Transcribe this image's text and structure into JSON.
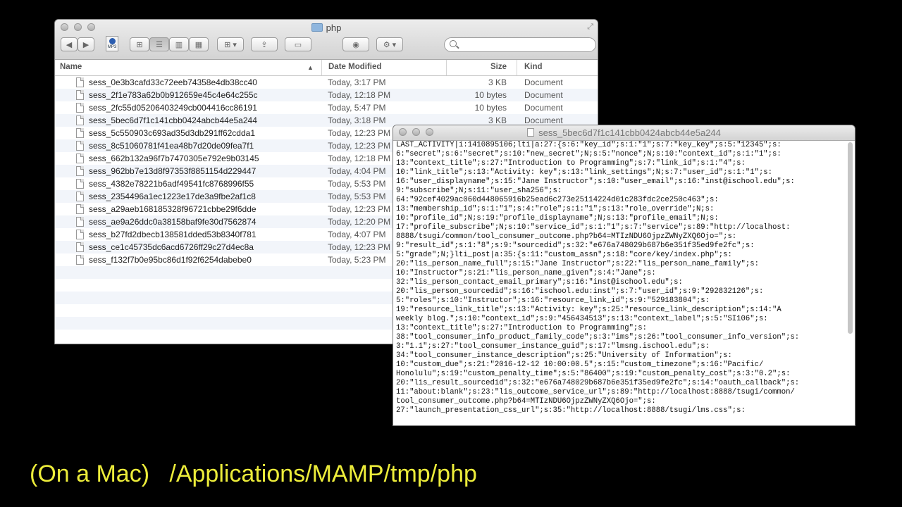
{
  "finder": {
    "title": "php",
    "toolbar_file_label": "MP3",
    "columns": {
      "name": "Name",
      "date": "Date Modified",
      "size": "Size",
      "kind": "Kind"
    },
    "sort_arrow": "▲",
    "files": [
      {
        "name": "sess_0e3b3cafd33c72eeb74358e4db38cc40",
        "date": "Today, 3:17 PM",
        "size": "3 KB",
        "kind": "Document"
      },
      {
        "name": "sess_2f1e783a62b0b912659e45c4e64c255c",
        "date": "Today, 12:18 PM",
        "size": "10 bytes",
        "kind": "Document"
      },
      {
        "name": "sess_2fc55d05206403249cb004416cc86191",
        "date": "Today, 5:47 PM",
        "size": "10 bytes",
        "kind": "Document"
      },
      {
        "name": "sess_5bec6d7f1c141cbb0424abcb44e5a244",
        "date": "Today, 3:18 PM",
        "size": "3 KB",
        "kind": "Document"
      },
      {
        "name": "sess_5c550903c693ad35d3db291ff62cdda1",
        "date": "Today, 12:23 PM",
        "size": "",
        "kind": ""
      },
      {
        "name": "sess_8c51060781f41ea48b7d20de09fea7f1",
        "date": "Today, 12:23 PM",
        "size": "",
        "kind": ""
      },
      {
        "name": "sess_662b132a96f7b7470305e792e9b03145",
        "date": "Today, 12:18 PM",
        "size": "",
        "kind": ""
      },
      {
        "name": "sess_962bb7e13d8f97353f8851154d229447",
        "date": "Today, 4:04 PM",
        "size": "",
        "kind": ""
      },
      {
        "name": "sess_4382e78221b6adf49541fc8768996f55",
        "date": "Today, 5:53 PM",
        "size": "",
        "kind": ""
      },
      {
        "name": "sess_2354496a1ec1223e17de3a9fbe2af1c8",
        "date": "Today, 5:53 PM",
        "size": "",
        "kind": ""
      },
      {
        "name": "sess_a29aeb168185328f96721cbbe29f6dde",
        "date": "Today, 12:23 PM",
        "size": "",
        "kind": ""
      },
      {
        "name": "sess_ae9a26ddc0a38158baf9fe30d7562874",
        "date": "Today, 12:20 PM",
        "size": "",
        "kind": ""
      },
      {
        "name": "sess_b27fd2dbecb138581dded53b8340f781",
        "date": "Today, 4:07 PM",
        "size": "",
        "kind": ""
      },
      {
        "name": "sess_ce1c45735dc6acd6726ff29c27d4ec8a",
        "date": "Today, 12:23 PM",
        "size": "",
        "kind": ""
      },
      {
        "name": "sess_f132f7b0e95bc86d1f92f6254dabebe0",
        "date": "Today, 5:23 PM",
        "size": "",
        "kind": ""
      }
    ]
  },
  "viewer": {
    "title": "sess_5bec6d7f1c141cbb0424abcb44e5a244",
    "lines": [
      "LAST_ACTIVITY|i:1410895106;lti|a:27:{s:6:\"key_id\";s:1:\"1\";s:7:\"key_key\";s:5:\"12345\";s:",
      "6:\"secret\";s:6:\"secret\";s:10:\"new_secret\";N;s:5:\"nonce\";N;s:10:\"context_id\";s:1:\"1\";s:",
      "13:\"context_title\";s:27:\"Introduction to Programming\";s:7:\"link_id\";s:1:\"4\";s:",
      "10:\"link_title\";s:13:\"Activity: key\";s:13:\"link_settings\";N;s:7:\"user_id\";s:1:\"1\";s:",
      "16:\"user_displayname\";s:15:\"Jane Instructor\";s:10:\"user_email\";s:16:\"inst@ischool.edu\";s:",
      "9:\"subscribe\";N;s:11:\"user_sha256\";s:",
      "64:\"92cef4029ac060d448065916b25ead6c273e25114224d01c283fdc2ce250c463\";s:",
      "13:\"membership_id\";s:1:\"1\";s:4:\"role\";s:1:\"1\";s:13:\"role_override\";N;s:",
      "10:\"profile_id\";N;s:19:\"profile_displayname\";N;s:13:\"profile_email\";N;s:",
      "17:\"profile_subscribe\";N;s:10:\"service_id\";s:1:\"1\";s:7:\"service\";s:89:\"http://localhost:",
      "8888/tsugi/common/tool_consumer_outcome.php?b64=MTIzNDU6OjpzZWNyZXQ6Ojo=\";s:",
      "9:\"result_id\";s:1:\"8\";s:9:\"sourcedid\";s:32:\"e676a748029b687b6e351f35ed9fe2fc\";s:",
      "5:\"grade\";N;}lti_post|a:35:{s:11:\"custom_assn\";s:18:\"core/key/index.php\";s:",
      "20:\"lis_person_name_full\";s:15:\"Jane Instructor\";s:22:\"lis_person_name_family\";s:",
      "10:\"Instructor\";s:21:\"lis_person_name_given\";s:4:\"Jane\";s:",
      "32:\"lis_person_contact_email_primary\";s:16:\"inst@ischool.edu\";s:",
      "20:\"lis_person_sourcedid\";s:16:\"ischool.edu:inst\";s:7:\"user_id\";s:9:\"292832126\";s:",
      "5:\"roles\";s:10:\"Instructor\";s:16:\"resource_link_id\";s:9:\"529183804\";s:",
      "19:\"resource_link_title\";s:13:\"Activity: key\";s:25:\"resource_link_description\";s:14:\"A",
      "weekly blog.\";s:10:\"context_id\";s:9:\"456434513\";s:13:\"context_label\";s:5:\"SI106\";s:",
      "13:\"context_title\";s:27:\"Introduction to Programming\";s:",
      "38:\"tool_consumer_info_product_family_code\";s:3:\"ims\";s:26:\"tool_consumer_info_version\";s:",
      "3:\"1.1\";s:27:\"tool_consumer_instance_guid\";s:17:\"lmsng.ischool.edu\";s:",
      "34:\"tool_consumer_instance_description\";s:25:\"University of Information\";s:",
      "10:\"custom_due\";s:21:\"2016-12-12 10:00:00.5\";s:15:\"custom_timezone\";s:16:\"Pacific/",
      "Honolulu\";s:19:\"custom_penalty_time\";s:5:\"86400\";s:19:\"custom_penalty_cost\";s:3:\"0.2\";s:",
      "20:\"lis_result_sourcedid\";s:32:\"e676a748029b687b6e351f35ed9fe2fc\";s:14:\"oauth_callback\";s:",
      "11:\"about:blank\";s:23:\"lis_outcome_service_url\";s:89:\"http://localhost:8888/tsugi/common/",
      "tool_consumer_outcome.php?b64=MTIzNDU6OjpzZWNyZXQ6Ojo=\";s:",
      "27:\"launch_presentation_css_url\";s:35:\"http://localhost:8888/tsugi/lms.css\";s:"
    ]
  },
  "caption": "(On a Mac)   /Applications/MAMP/tmp/php"
}
